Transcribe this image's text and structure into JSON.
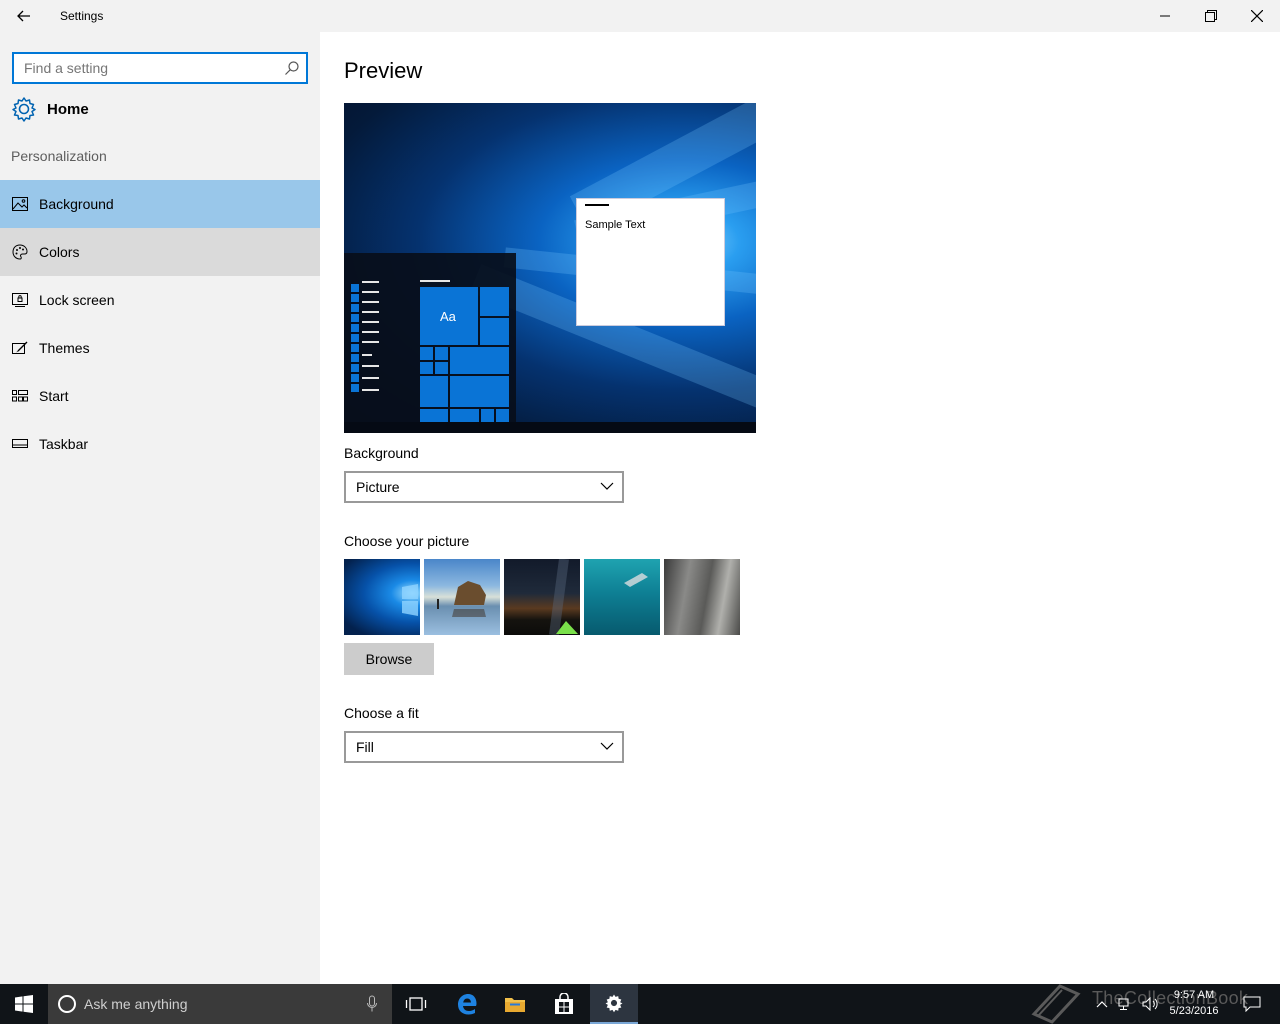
{
  "window": {
    "title": "Settings"
  },
  "search": {
    "placeholder": "Find a setting"
  },
  "sidebar": {
    "home_label": "Home",
    "section_label": "Personalization",
    "items": [
      {
        "label": "Background",
        "icon": "picture-icon",
        "state": "selected"
      },
      {
        "label": "Colors",
        "icon": "palette-icon",
        "state": "hover"
      },
      {
        "label": "Lock screen",
        "icon": "lock-screen-icon",
        "state": "normal"
      },
      {
        "label": "Themes",
        "icon": "themes-icon",
        "state": "normal"
      },
      {
        "label": "Start",
        "icon": "start-icon",
        "state": "normal"
      },
      {
        "label": "Taskbar",
        "icon": "taskbar-icon",
        "state": "normal"
      }
    ]
  },
  "main": {
    "heading": "Preview",
    "preview": {
      "sample_text": "Sample Text",
      "tile_label": "Aa"
    },
    "background": {
      "label": "Background",
      "value": "Picture"
    },
    "choose_picture": {
      "label": "Choose your picture",
      "thumbnails": [
        "windows-hero",
        "beach-rocks",
        "milky-way-tent",
        "underwater-swimmer",
        "rock-cliff"
      ]
    },
    "browse_label": "Browse",
    "fit": {
      "label": "Choose a fit",
      "value": "Fill"
    }
  },
  "taskbar": {
    "search_placeholder": "Ask me anything",
    "time": "9:57 AM",
    "date": "5/23/2016",
    "watermark": "TheCollectionBook"
  },
  "colors": {
    "accent": "#0078d7",
    "selected_item": "#99c7ea",
    "sidebar_bg": "#f2f2f2",
    "taskbar_bg": "#101418"
  }
}
